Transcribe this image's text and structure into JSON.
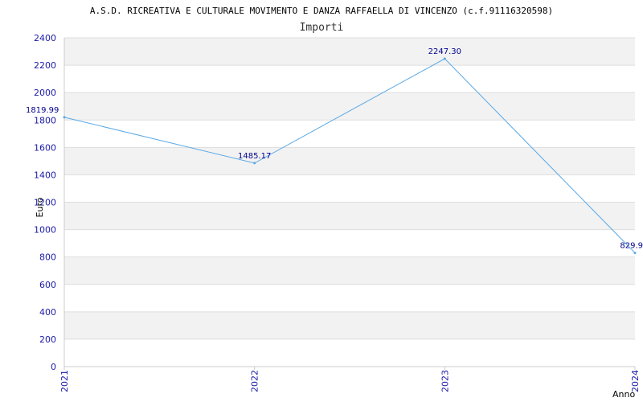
{
  "chart_data": {
    "type": "line",
    "title": "A.S.D. RICREATIVA E CULTURALE MOVIMENTO E DANZA RAFFAELLA DI VINCENZO (c.f.91116320598)",
    "subtitle": "Importi",
    "xlabel": "Anno",
    "ylabel": "Euro",
    "categories": [
      "2021",
      "2022",
      "2023",
      "2024"
    ],
    "series": [
      {
        "values": [
          1819.99,
          1485.17,
          2247.3,
          829.9
        ],
        "labels": [
          "1819.99",
          "1485.17",
          "2247.30",
          "829.9"
        ]
      }
    ],
    "ylim": [
      0,
      2400
    ],
    "yticks": [
      "0",
      "200",
      "400",
      "600",
      "800",
      "1000",
      "1200",
      "1400",
      "1600",
      "1800",
      "2000",
      "2200",
      "2400"
    ],
    "grid": true,
    "colors": {
      "line": "#5aa9e6",
      "band": "#f2f2f2",
      "gridline": "#dddddd",
      "tick_text": "#1a1aa8",
      "data_label": "#00008b"
    }
  }
}
